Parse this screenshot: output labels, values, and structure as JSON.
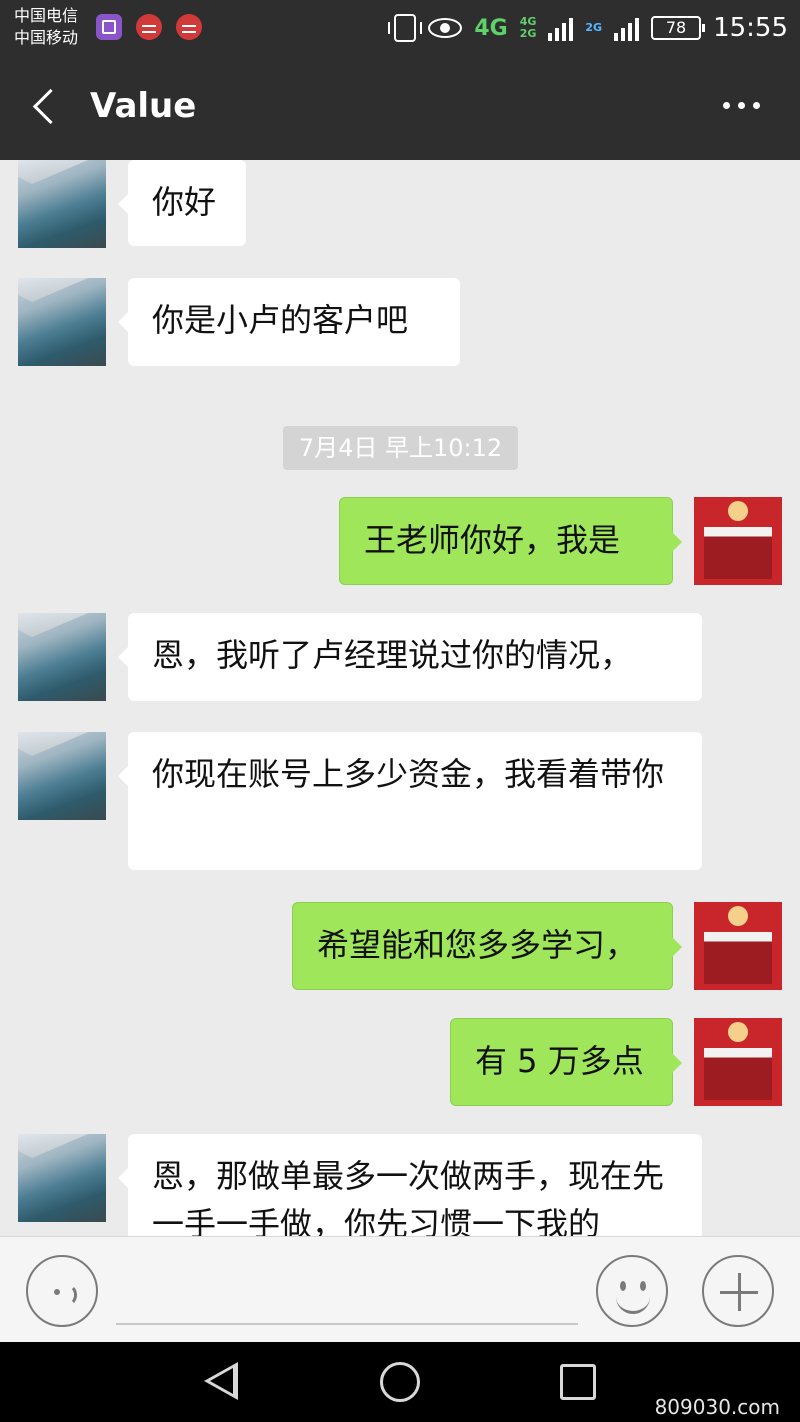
{
  "status_bar": {
    "carrier_1": "中国电信",
    "carrier_2": "中国移动",
    "network_main": "4G",
    "network_secondary_top": "4G",
    "network_secondary_bottom": "2G",
    "network_tertiary": "2G",
    "battery_level": "78",
    "time": "15:55"
  },
  "header": {
    "title": "Value"
  },
  "messages": [
    {
      "sender": "contact",
      "text": "你好"
    },
    {
      "sender": "contact",
      "text": "你是小卢的客户吧"
    },
    {
      "type": "timestamp",
      "text": "7月4日 早上10:12"
    },
    {
      "sender": "me",
      "text": "王老师你好，我是"
    },
    {
      "sender": "contact",
      "text": "恩，我听了卢经理说过你的情况，"
    },
    {
      "sender": "contact",
      "text": "你现在账号上多少资金，我看着带你"
    },
    {
      "sender": "me",
      "text": "希望能和您多多学习，"
    },
    {
      "sender": "me",
      "text": "有 5 万多点"
    },
    {
      "sender": "contact",
      "text": "恩，那做单最多一次做两手，现在先一手一手做，你先习惯一下我的"
    }
  ],
  "watermark_site": "809030.com",
  "colors": {
    "header_bg": "#2e2e2e",
    "chat_bg": "#ebebeb",
    "outgoing_bubble": "#9fe65a",
    "incoming_bubble": "#ffffff"
  }
}
